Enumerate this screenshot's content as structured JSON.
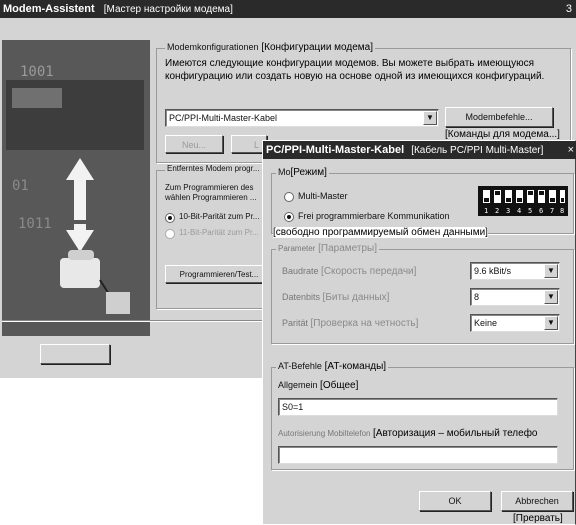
{
  "main_window": {
    "title": "Modem-Assistent",
    "title_ann": "[Мастер настройки модема]",
    "group1": {
      "legend": "Modemkonfigurationen",
      "legend_ann": "[Конфигурации модема]",
      "desc_ru": "Имеются следующие конфигурации модемов. Вы можете выбрать имеющуюся конфигурацию или создать новую на основе одной из имеющихся конфигураций.",
      "select_value": "PC/PPI-Multi-Master-Kabel",
      "commands_button": "Modembefehle...",
      "commands_ann": "[Команды для модема...]",
      "new_button": "Neu...",
      "partial_button": "L"
    },
    "group2": {
      "legend": "Entferntes Modem progr...",
      "line1": "Zum Programmieren des",
      "line2": "wählen Programmieren ...",
      "radio1": "10-Bit-Parität zum Pr...",
      "radio2": "11-Bit-Parität zum Pr...",
      "program_button": "Programmieren/Test..."
    }
  },
  "dialog": {
    "title": "PC/PPI-Multi-Master-Kabel",
    "title_ann": "[Кабель PC/PPI Multi-Master]",
    "mode_group": {
      "legend": "Mo",
      "legend_ann": "[Режим]",
      "option1": "Multi-Master",
      "option2": "Frei programmierbare Kommunikation",
      "option2_ann": "[свободно программируемый обмен данными]",
      "dip_numbers": [
        "1",
        "2",
        "3",
        "4",
        "5",
        "6",
        "7",
        "8"
      ]
    },
    "params_group": {
      "legend": "Parameter",
      "legend_ann": "[Параметры]",
      "baud_label": "Baudrate",
      "baud_ann": "[Скорость передачи]",
      "baud_value": "9.6 kBit/s",
      "databits_label": "Datenbits",
      "databits_ann": "[Биты данных]",
      "databits_value": "8",
      "parity_label": "Parität",
      "parity_ann": "[Проверка на четность]",
      "parity_value": "Keine"
    },
    "at_group": {
      "legend": "AT-Befehle",
      "legend_ann": "[AT-команды]",
      "general_label": "Allgemein",
      "general_ann": "[Общее]",
      "general_value": "S0=1",
      "auth_label": "Autorisierung Mobiltelefon",
      "auth_ann": "[Авторизация – мобильный телефо",
      "auth_value": ""
    },
    "ok_button": "OK",
    "cancel_button": "Abbrechen",
    "cancel_ann": "[Прервать]"
  }
}
